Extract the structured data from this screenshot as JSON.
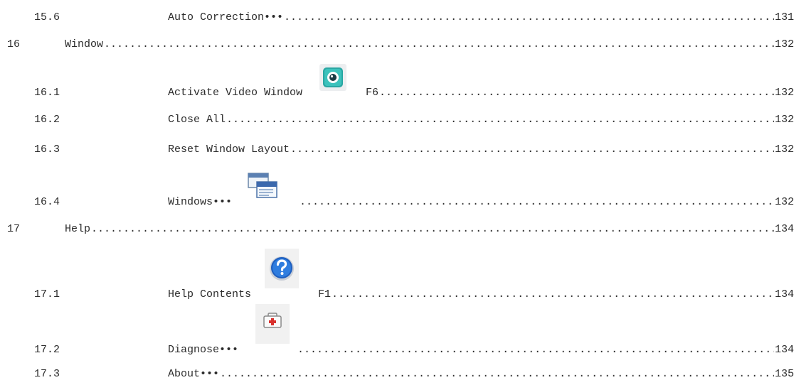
{
  "toc": [
    {
      "level": 2,
      "number": "15.6",
      "title": "Auto Correction•••",
      "page": "131"
    },
    {
      "level": 1,
      "number": "16",
      "title": "Window",
      "page": "132"
    },
    {
      "level": 2,
      "number": "16.1",
      "title": "Activate Video Window",
      "icon": "video-camera-icon",
      "shortcut": "F6",
      "page": "132"
    },
    {
      "level": 2,
      "number": "16.2",
      "title": "Close All",
      "page": "132"
    },
    {
      "level": 2,
      "number": "16.3",
      "title": "Reset Window Layout",
      "page": "132"
    },
    {
      "level": 2,
      "number": "16.4",
      "title": "Windows•••",
      "icon": "cascade-windows-icon",
      "page": "132"
    },
    {
      "level": 1,
      "number": "17",
      "title": "Help",
      "page": "134"
    },
    {
      "level": 2,
      "number": "17.1",
      "title": "Help Contents",
      "icon": "help-question-icon",
      "shortcut": "F1",
      "page": "134"
    },
    {
      "level": 2,
      "number": "17.2",
      "title": "Diagnose•••",
      "icon": "first-aid-kit-icon",
      "page": "134"
    },
    {
      "level": 2,
      "number": "17.3",
      "title": "About•••",
      "page": "135"
    }
  ]
}
